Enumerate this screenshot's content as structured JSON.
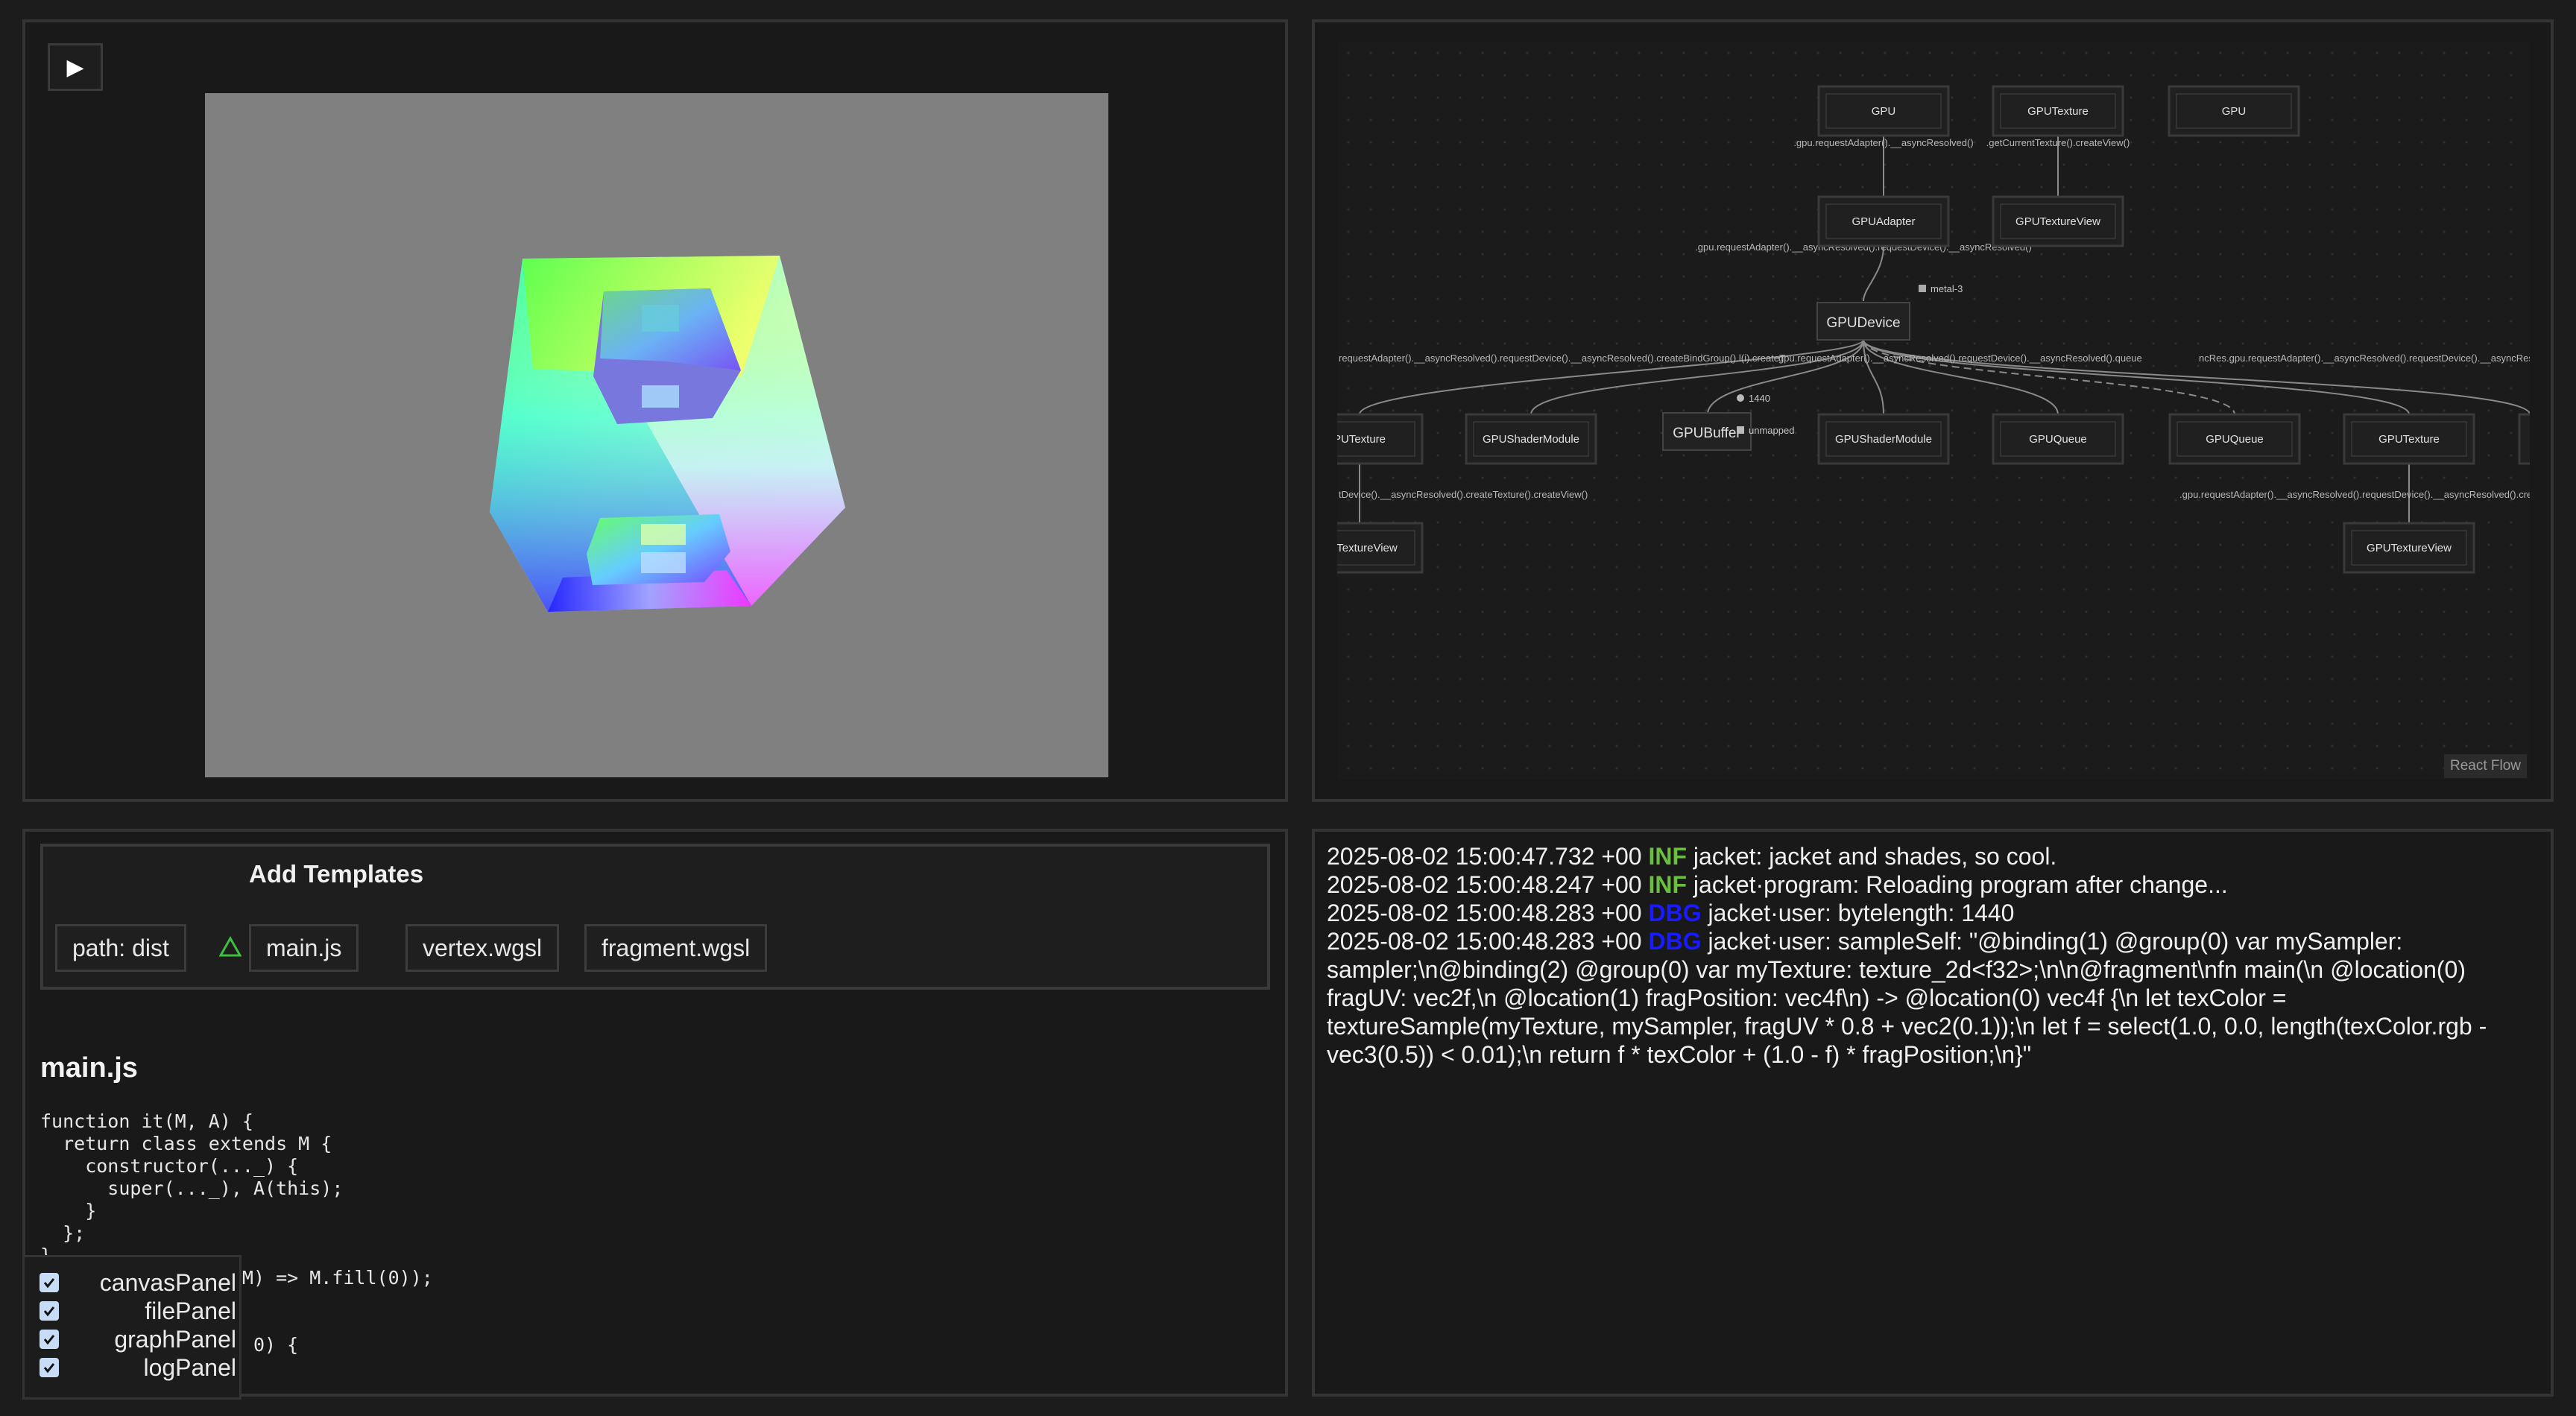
{
  "canvasPanel": {
    "play_label": "▶"
  },
  "graph": {
    "attribution": "React Flow",
    "nodes": {
      "gpu1": "GPU",
      "gpuTexture1": "GPUTexture",
      "gpu2": "GPU",
      "adapter": "GPUAdapter",
      "textureView1": "GPUTextureView",
      "device": "GPUDevice",
      "deviceBadge": "metal-3",
      "textureLeft": "PUTexture",
      "shaderModule1": "GPUShaderModule",
      "buffer": "GPUBuffer",
      "bufferSize": "1440",
      "bufferState": "unmapped",
      "shaderModule2": "GPUShaderModule",
      "queue1": "GPUQueue",
      "queue2": "GPUQueue",
      "gpuTexture2": "GPUTexture",
      "textureViewLeft": "TextureView",
      "textureView2": "GPUTextureView"
    },
    "edges": {
      "e1": ".gpu.requestAdapter().__asyncResolved()",
      "e2": ".getCurrentTexture().createView()",
      "e3": ".gpu.requestAdapter().__asyncResolved().requestDevice().__asyncResolved()",
      "e4": "requestAdapter().__asyncResolved().requestDevice().__asyncResolved().createBindGroup().l(i).createT",
      "e5": "gpu.requestAdapter().__asyncResolved().requestDevice().__asyncResolved().queue",
      "e6": "ncRes",
      "e7": ".gpu.requestAdapter().__asyncResolved().requestDevice().__asyncResolved().crea",
      "e8": "tDevice().__asyncResolved().createTexture().createView()",
      "e9": ".gpu.requestAdapter().__asyncResolved().requestDevice().__asyncResolved().crea"
    }
  },
  "filePanel": {
    "templates_title": "Add Templates",
    "tabs": {
      "path": "path: dist",
      "main": "main.js",
      "vertex": "vertex.wgsl",
      "fragment": "fragment.wgsl"
    },
    "file_title": "main.js",
    "code": "function it(M, A) {\n  return class extends M {\n    constructor(..._) {\n      super(..._), A(this);\n    }\n  };\n}\n             ay, (M) => M.fill(0));\n\n\n            ), d = 0) {\n             M(2);"
  },
  "log": {
    "lines": [
      {
        "ts": "2025-08-02 15:00:47.732 +00",
        "level": "INF",
        "msg": "jacket: jacket and shades, so cool."
      },
      {
        "ts": "2025-08-02 15:00:48.247 +00",
        "level": "INF",
        "msg": "jacket·program: Reloading program after change..."
      },
      {
        "ts": "2025-08-02 15:00:48.283 +00",
        "level": "DBG",
        "msg": "jacket·user: bytelength: 1440"
      },
      {
        "ts": "2025-08-02 15:00:48.283 +00",
        "level": "DBG",
        "msg": "jacket·user: sampleSelf: \"@binding(1) @group(0) var mySampler: sampler;\\n@binding(2) @group(0) var myTexture: texture_2d<f32>;\\n\\n@fragment\\nfn main(\\n @location(0) fragUV: vec2f,\\n @location(1) fragPosition: vec4f\\n) -> @location(0) vec4f {\\n let texColor = textureSample(myTexture, mySampler, fragUV * 0.8 + vec2(0.1));\\n let f = select(1.0, 0.0, length(texColor.rgb - vec3(0.5)) < 0.01);\\n return f * texColor + (1.0 - f) * fragPosition;\\n}\""
      }
    ]
  },
  "panels": [
    {
      "label": "canvasPanel",
      "checked": true
    },
    {
      "label": "filePanel",
      "checked": true
    },
    {
      "label": "graphPanel",
      "checked": true
    },
    {
      "label": "logPanel",
      "checked": true
    }
  ]
}
